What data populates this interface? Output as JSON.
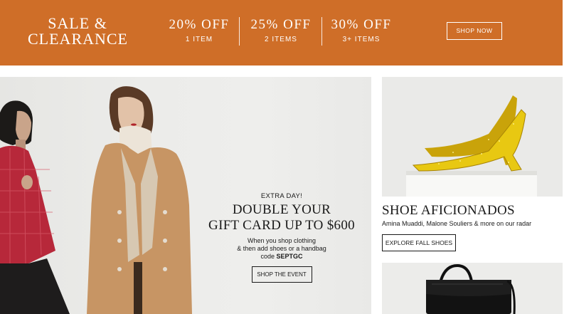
{
  "sale_banner": {
    "title_line1": "SALE &",
    "title_line2": "CLEARANCE",
    "offers": [
      {
        "percent": "20% OFF",
        "quantity": "1 ITEM"
      },
      {
        "percent": "25% OFF",
        "quantity": "2 ITEMS"
      },
      {
        "percent": "30% OFF",
        "quantity": "3+ ITEMS"
      }
    ],
    "cta_label": "SHOP NOW",
    "background_color": "#cf6e28"
  },
  "hero_promo": {
    "kicker": "EXTRA DAY!",
    "headline_line1": "DOUBLE YOUR",
    "headline_line2": "GIFT CARD UP TO $600",
    "body_line1": "When you shop clothing",
    "body_line2": "& then add shoes or a handbag",
    "code_prefix": "code ",
    "code": "SEPTGC",
    "cta_label": "SHOP THE EVENT"
  },
  "shoe_feature": {
    "heading": "SHOE AFICIONADOS",
    "subheading": "Amina Muaddi, Malone Souliers & more on our radar",
    "cta_label": "EXPLORE FALL SHOES"
  }
}
